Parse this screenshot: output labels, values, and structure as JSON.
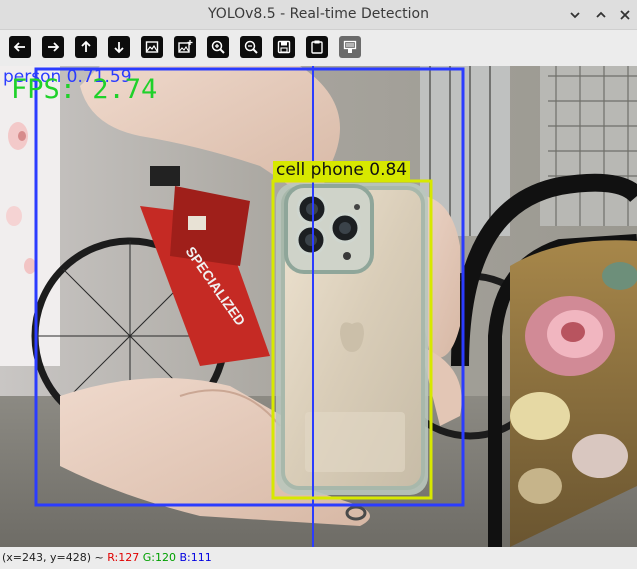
{
  "window": {
    "title": "YOLOv8.5 - Real-time Detection"
  },
  "toolbar": {
    "buttons": [
      {
        "name": "pan-left-button",
        "icon": "arrow-left-icon"
      },
      {
        "name": "pan-right-button",
        "icon": "arrow-right-icon"
      },
      {
        "name": "pan-up-button",
        "icon": "arrow-up-icon"
      },
      {
        "name": "pan-down-button",
        "icon": "arrow-down-icon"
      },
      {
        "name": "zoom-fit-button",
        "icon": "image-icon"
      },
      {
        "name": "zoom-original-button",
        "icon": "image-plus-icon"
      },
      {
        "name": "zoom-in-button",
        "icon": "zoom-in-icon"
      },
      {
        "name": "zoom-out-button",
        "icon": "zoom-out-icon"
      },
      {
        "name": "save-button",
        "icon": "save-icon"
      },
      {
        "name": "copy-button",
        "icon": "clipboard-icon"
      },
      {
        "name": "properties-button",
        "icon": "properties-icon"
      }
    ]
  },
  "overlay": {
    "fps": "FPS: 2.74",
    "detections": [
      {
        "label": "person 0.71.59",
        "color": "#2b3cff"
      },
      {
        "label": "cell phone 0.84",
        "color": "#d7e800"
      }
    ]
  },
  "status": {
    "coords": "(x=243, y=428) ~",
    "r": "R:127",
    "g": "G:120",
    "b": "B:111"
  },
  "colors": {
    "person_box": "#2b3cff",
    "phone_box": "#d7e800",
    "fps_text": "#1fd12a"
  }
}
